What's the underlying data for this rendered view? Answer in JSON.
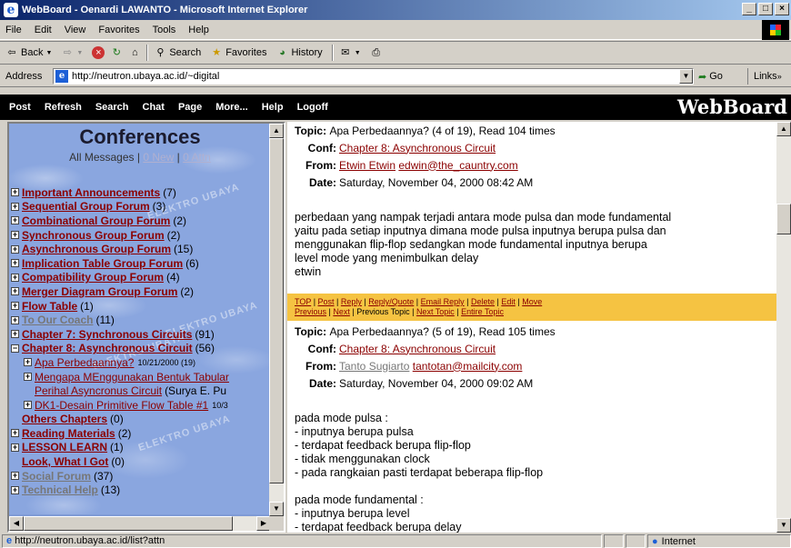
{
  "window": {
    "title": "WebBoard - Oenardi LAWANTO - Microsoft Internet Explorer",
    "controls": [
      "_",
      "×"
    ]
  },
  "menu": [
    "File",
    "Edit",
    "View",
    "Favorites",
    "Tools",
    "Help"
  ],
  "toolbar": {
    "back": "Back",
    "search": "Search",
    "favorites": "Favorites",
    "history": "History"
  },
  "address": {
    "label": "Address",
    "url": "http://neutron.ubaya.ac.id/~digital",
    "go": "Go",
    "links": "Links"
  },
  "nav": {
    "items": [
      "Post",
      "Refresh",
      "Search",
      "Chat",
      "Page",
      "More...",
      "Help",
      "Logoff"
    ],
    "brand": "WebBoard"
  },
  "left": {
    "title": "Conferences",
    "all_messages": "All Messages",
    "new": "0 New",
    "attn": "0 Attn",
    "watermark": "ELEKTRO UBAYA",
    "items": [
      {
        "label": "Important Announcements",
        "count": "(7)"
      },
      {
        "label": "Sequential Group Forum",
        "count": "(3)"
      },
      {
        "label": "Combinational Group Forum",
        "count": "(2)"
      },
      {
        "label": "Synchronous Group Forum",
        "count": "(2)"
      },
      {
        "label": "Asynchronous Group Forum",
        "count": "(15)"
      },
      {
        "label": "Implication Table Group Forum",
        "count": "(6)"
      },
      {
        "label": "Compatibility Group Forum",
        "count": "(4)"
      },
      {
        "label": "Merger Diagram Group Forum",
        "count": "(2)"
      },
      {
        "label": "Flow Table",
        "count": "(1)"
      },
      {
        "label": "To Our Coach",
        "count": "(11)"
      },
      {
        "label": "Chapter 7: Synchronous Circuits",
        "count": "(91)"
      },
      {
        "label": "Chapter 8: Asynchronous Circuit",
        "count": "(56)"
      }
    ],
    "sub": [
      {
        "label": "Apa Perbedaannya?",
        "date": "10/21/2000 (19)"
      },
      {
        "label": "Mengapa MEnggunakan Bentuk Tabular"
      },
      {
        "label": "Perihal Asyncronus Circuit",
        "extra": "(Surya E. Pu"
      },
      {
        "label": "DK1-Desain Primitive Flow Table #1",
        "date": "10/3"
      }
    ],
    "items2": [
      {
        "label": "Others Chapters",
        "count": "(0)"
      },
      {
        "label": "Reading Materials",
        "count": "(2)"
      },
      {
        "label": "LESSON LEARN",
        "count": "(1)"
      },
      {
        "label": "Look, What I Got",
        "count": "(0)"
      },
      {
        "label": "Social Forum",
        "count": "(37)"
      },
      {
        "label": "Technical Help",
        "count": "(13)"
      }
    ]
  },
  "msg1": {
    "topic_label": "Topic:",
    "topic": "Apa Perbedaannya? (4 of 19), Read 104 times",
    "conf_label": "Conf:",
    "conf": "Chapter 8: Asynchronous Circuit",
    "from_label": "From:",
    "from_name": "Etwin Etwin",
    "from_email": "edwin@the_cauntry.com",
    "date_label": "Date:",
    "date": "Saturday, November 04, 2000 08:42 AM",
    "body": [
      "perbedaan yang nampak terjadi antara mode pulsa dan mode fundamental",
      "yaitu pada setiap inputnya dimana mode pulsa inputnya berupa pulsa dan",
      "menggunakan flip-flop sedangkan mode fundamental inputnya berupa",
      "level mode yang menimbulkan delay",
      "etwin"
    ]
  },
  "actions": {
    "row1": [
      "TOP",
      "Post",
      "Reply",
      "Reply/Quote",
      "Email Reply",
      "Delete",
      "Edit",
      "Move"
    ],
    "row2": [
      "Previous",
      "Next",
      "Previous Topic",
      "Next Topic",
      "Entire Topic"
    ]
  },
  "msg2": {
    "topic_label": "Topic:",
    "topic": "Apa Perbedaannya? (5 of 19), Read 105 times",
    "conf_label": "Conf:",
    "conf": "Chapter 8: Asynchronous Circuit",
    "from_label": "From:",
    "from_name": "Tanto Sugiarto",
    "from_email": "tantotan@mailcity.com",
    "date_label": "Date:",
    "date": "Saturday, November 04, 2000 09:02 AM",
    "body1": [
      "pada mode pulsa :",
      "- inputnya berupa pulsa",
      "- terdapat feedback berupa flip-flop",
      "- tidak menggunakan clock",
      "- pada rangkaian pasti terdapat beberapa flip-flop"
    ],
    "body2": [
      "pada mode fundamental :",
      "- inputnya berupa level",
      "- terdapat feedback berupa delay"
    ]
  },
  "status": {
    "url": "http://neutron.ubaya.ac.id/list?attn",
    "zone": "Internet"
  }
}
